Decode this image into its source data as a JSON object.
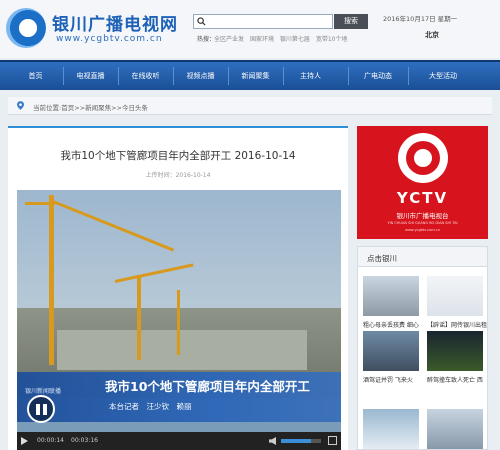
{
  "site": {
    "title": "银川广播电视网",
    "url": "www.ycgbtv.com.cn"
  },
  "search": {
    "placeholder": "",
    "button": "搜索",
    "hot_label": "热搜：",
    "hot_links": [
      "全区产业发",
      "国家环境",
      "银川第七届",
      "宽带10个地"
    ]
  },
  "header": {
    "date": "2016年10月17日 星期一",
    "city": "北京"
  },
  "nav": {
    "items": [
      "首页",
      "电视直播",
      "在线收听",
      "视频点播",
      "新闻聚集",
      "主持人",
      "广电动态",
      "大型活动"
    ]
  },
  "breadcrumb": {
    "text": "当前位置:首页>>新闻聚焦>>今日头条"
  },
  "article": {
    "title": "我市10个地下管廊项目年内全部开工 2016-10-14",
    "meta": "上传时间：2016-10-14"
  },
  "video": {
    "caption": "我市10个地下管廊项目年内全部开工",
    "reporter": "本台记者　汪少钦　赖丽",
    "logo": "银川新闻联播",
    "current_time": "00:00:14",
    "duration": "00:03:16",
    "volume": 0.75
  },
  "ad": {
    "brand": "YCTV",
    "sub": "银川市广播电视台",
    "pinyin": "YIN CHUAN SHI GUANG BO DIAN SHI TAI",
    "url": "www.ycgbtv.com.cn"
  },
  "sidebar": {
    "title": "点击银川",
    "items": [
      {
        "caption": "粗心母亲丢孩费 细心"
      },
      {
        "caption": "【辟谣】网传银川出租"
      },
      {
        "caption": "酒驾证并罚 飞来火"
      },
      {
        "caption": "醉驾撞车致人死亡 西"
      },
      {
        "caption": ""
      },
      {
        "caption": ""
      }
    ]
  },
  "colors": {
    "nav": "#1f5ba8",
    "accent": "#2f8fd6",
    "ad": "#d7141d"
  }
}
